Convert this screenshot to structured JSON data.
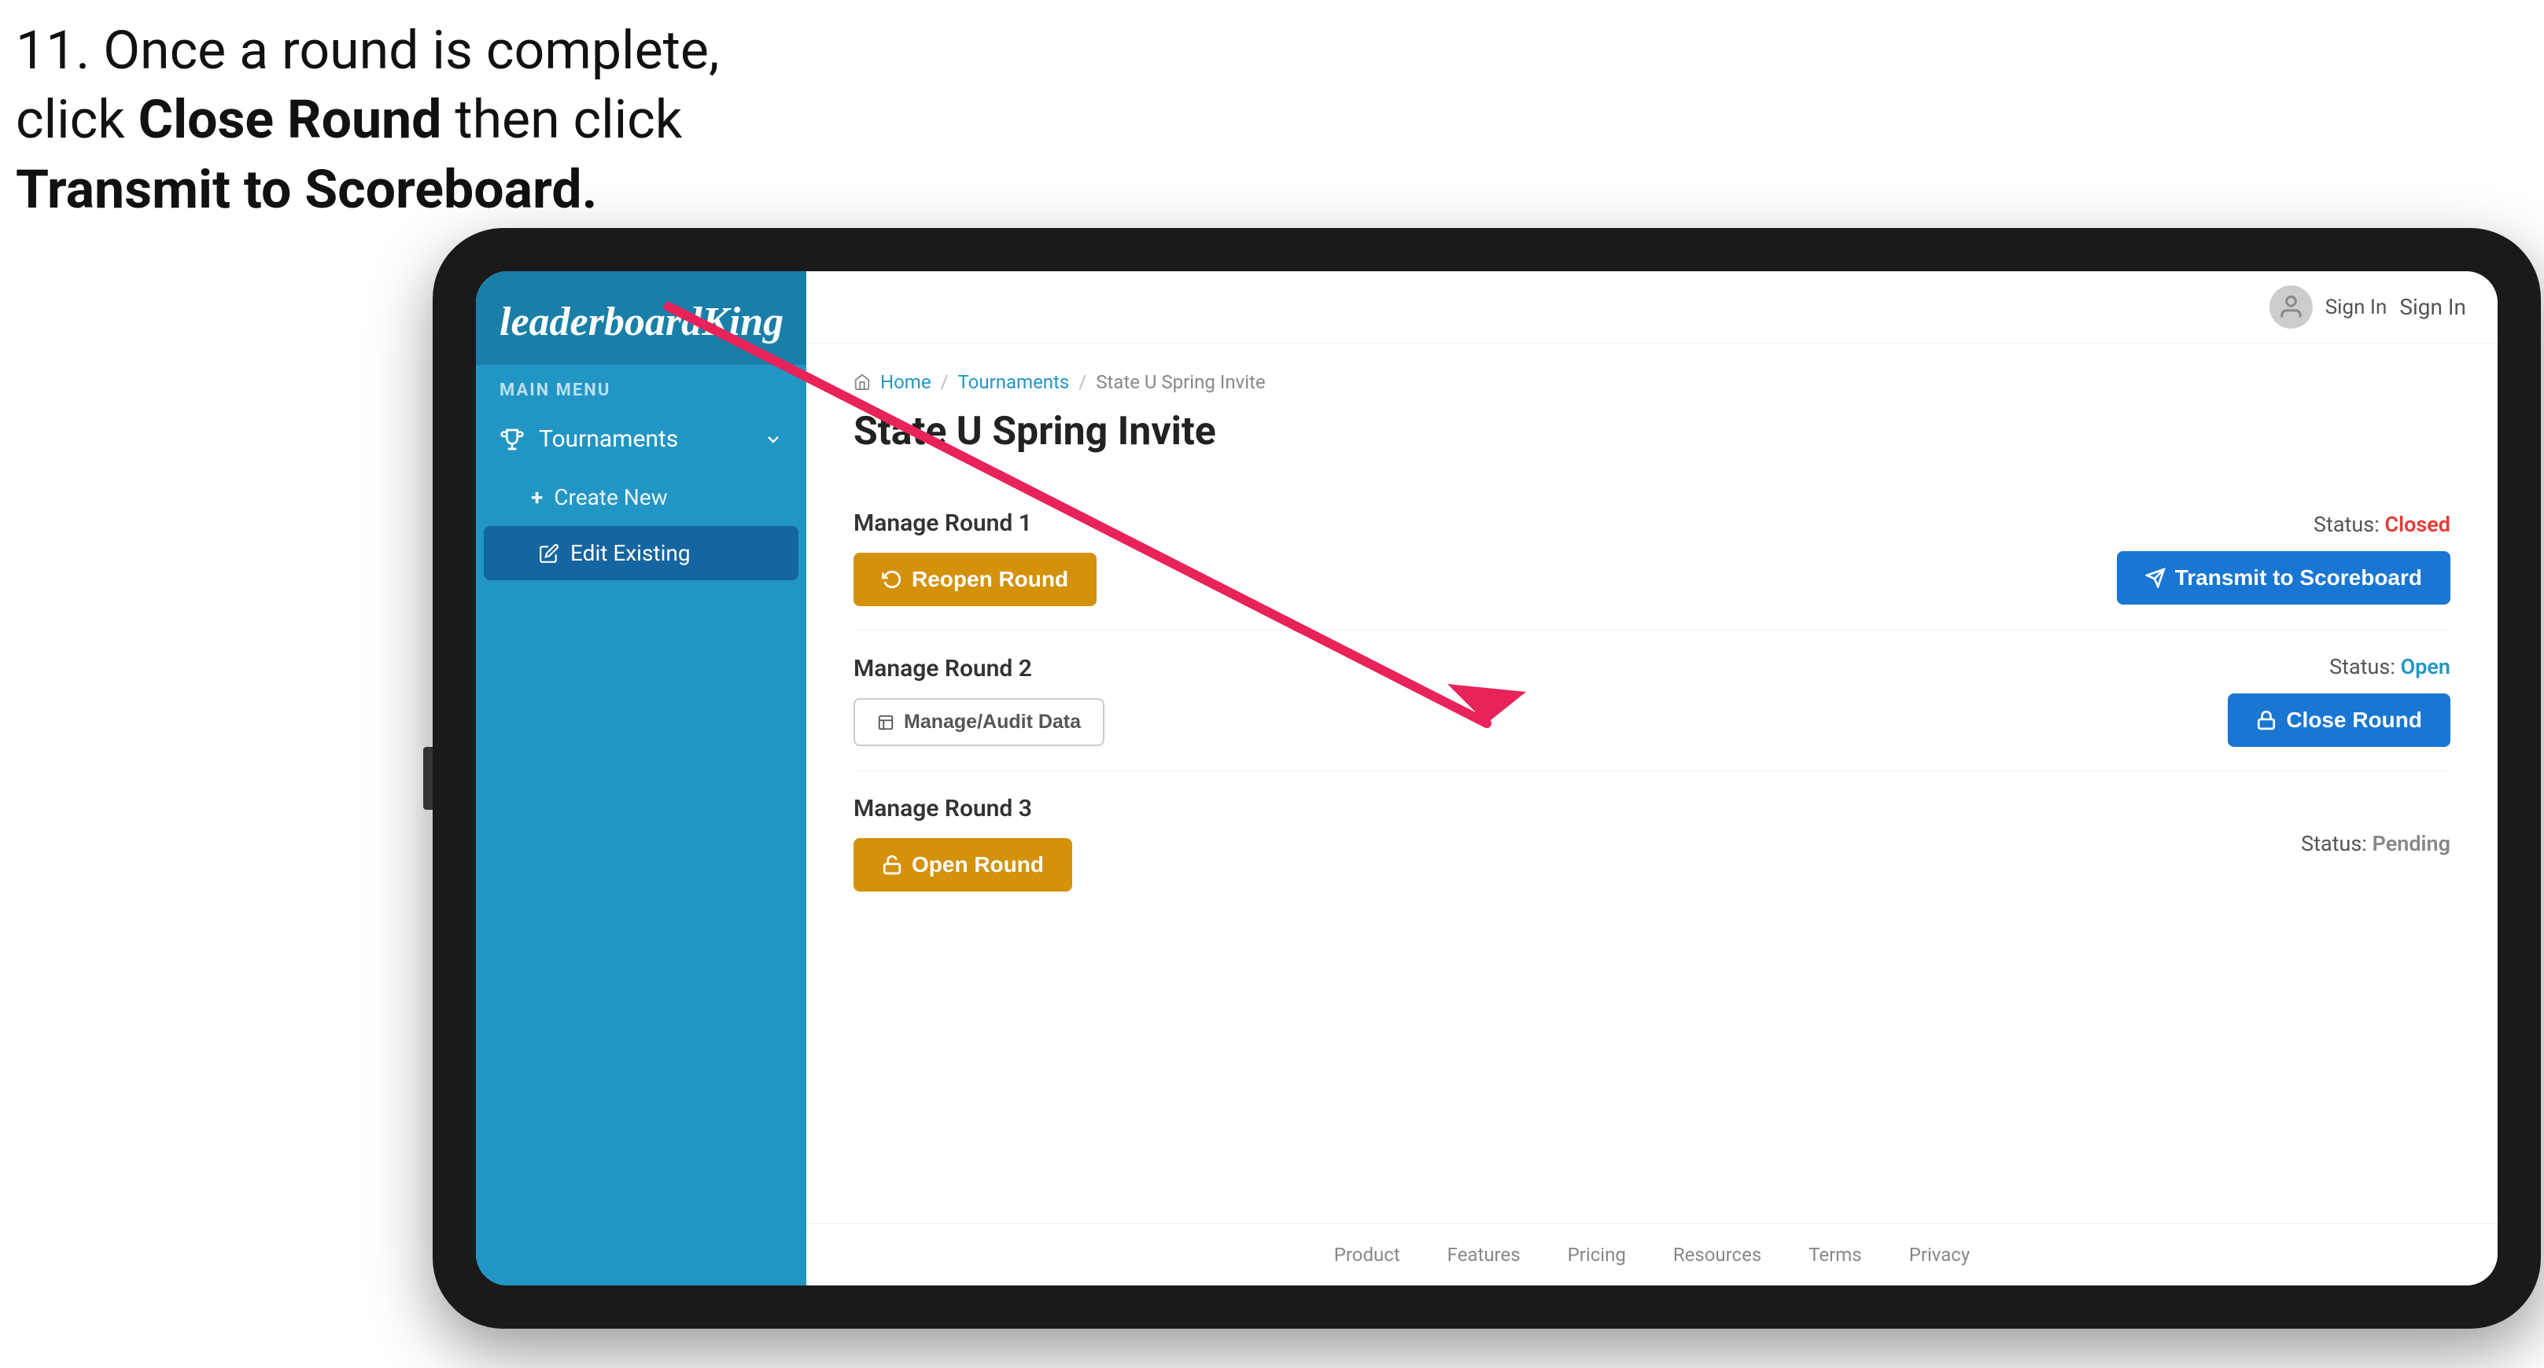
{
  "instruction": {
    "line1": "11. Once a round is complete,",
    "line2": "click ",
    "bold1": "Close Round",
    "line3": " then click",
    "line4": "",
    "bold2": "Transmit to Scoreboard."
  },
  "header": {
    "sign_in": "Sign In"
  },
  "logo": {
    "text1": "leaderboard",
    "text2": "King"
  },
  "sidebar": {
    "main_menu_label": "MAIN MENU",
    "nav_items": [
      {
        "label": "Tournaments",
        "has_arrow": true
      }
    ],
    "sub_items": [
      {
        "label": "Create New",
        "icon": "+"
      },
      {
        "label": "Edit Existing",
        "active": true
      }
    ]
  },
  "breadcrumb": {
    "home": "Home",
    "tournaments": "Tournaments",
    "current": "State U Spring Invite"
  },
  "page": {
    "title": "State U Spring Invite"
  },
  "rounds": [
    {
      "label": "Manage Round 1",
      "status_label": "Status:",
      "status_value": "Closed",
      "status_type": "closed",
      "btn1_label": "Reopen Round",
      "btn2_label": "Transmit to Scoreboard",
      "btn1_type": "gold",
      "btn2_type": "blue",
      "has_audit": false
    },
    {
      "label": "Manage Round 2",
      "status_label": "Status:",
      "status_value": "Open",
      "status_type": "open",
      "btn1_label": "Manage/Audit Data",
      "btn2_label": "Close Round",
      "btn1_type": "outline",
      "btn2_type": "blue",
      "has_audit": true
    },
    {
      "label": "Manage Round 3",
      "status_label": "Status:",
      "status_value": "Pending",
      "status_type": "pending",
      "btn1_label": "Open Round",
      "btn2_label": null,
      "btn1_type": "gold",
      "btn2_type": null,
      "has_audit": false
    }
  ],
  "footer": {
    "links": [
      "Product",
      "Features",
      "Pricing",
      "Resources",
      "Terms",
      "Privacy"
    ]
  },
  "colors": {
    "sidebar_bg": "#2196c4",
    "sidebar_active": "#1565a0",
    "btn_gold": "#d4920a",
    "btn_blue": "#1976d2",
    "status_closed": "#e53935",
    "status_open": "#2196c4",
    "status_pending": "#888888"
  }
}
